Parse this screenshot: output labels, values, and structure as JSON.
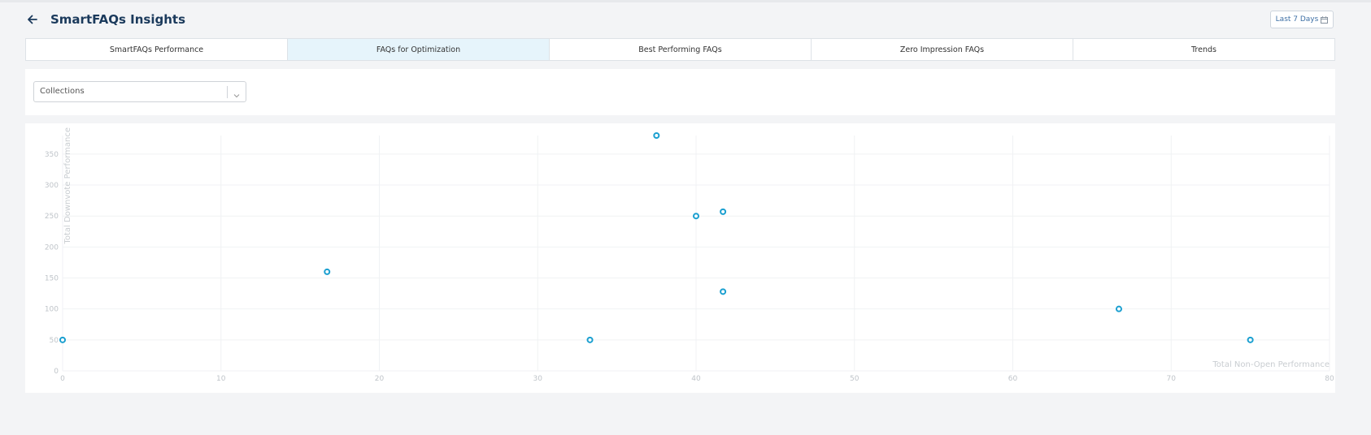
{
  "header": {
    "title": "SmartFAQs Insights",
    "date_range_label": "Last 7 Days"
  },
  "tabs": [
    {
      "label": "SmartFAQs Performance",
      "active": false
    },
    {
      "label": "FAQs for Optimization",
      "active": true
    },
    {
      "label": "Best Performing FAQs",
      "active": false
    },
    {
      "label": "Zero Impression FAQs",
      "active": false
    },
    {
      "label": "Trends",
      "active": false
    }
  ],
  "filters": {
    "collections": {
      "value": "Collections"
    }
  },
  "colors": {
    "accent": "#1b3a5c",
    "point_stroke": "#1a9fd0",
    "active_tab": "#e6f4fb"
  },
  "chart_data": {
    "type": "scatter",
    "xlabel": "Total Non-Open Performance",
    "ylabel": "Total Downvote Performance",
    "xlim": [
      0,
      80
    ],
    "ylim": [
      0,
      380
    ],
    "x_ticks": [
      0,
      10,
      20,
      30,
      40,
      50,
      60,
      70,
      80
    ],
    "y_ticks": [
      0,
      50,
      100,
      150,
      200,
      250,
      300,
      350
    ],
    "grid": true,
    "points": [
      {
        "x": 0,
        "y": 50
      },
      {
        "x": 16.7,
        "y": 160
      },
      {
        "x": 33.3,
        "y": 50
      },
      {
        "x": 37.5,
        "y": 380
      },
      {
        "x": 40,
        "y": 250
      },
      {
        "x": 41.7,
        "y": 257
      },
      {
        "x": 41.7,
        "y": 128
      },
      {
        "x": 66.7,
        "y": 100
      },
      {
        "x": 75,
        "y": 50
      }
    ]
  }
}
